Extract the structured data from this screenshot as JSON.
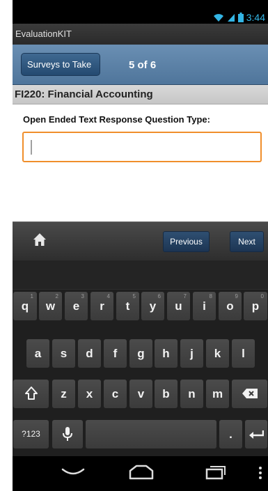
{
  "status_bar": {
    "time": "3:44",
    "icons": [
      "wifi-icon",
      "signal-icon",
      "battery-icon"
    ]
  },
  "app": {
    "title": "EvaluationKIT"
  },
  "nav": {
    "back_label": "Surveys to Take",
    "page_counter": "5 of 6"
  },
  "course": {
    "title": "FI220:  Financial Accounting"
  },
  "question": {
    "label": "Open Ended Text Response Question Type:",
    "value": ""
  },
  "toolbar": {
    "home_icon": "home-icon",
    "previous_label": "Previous",
    "next_label": "Next"
  },
  "keyboard": {
    "row1": [
      "q",
      "w",
      "e",
      "r",
      "t",
      "y",
      "u",
      "i",
      "o",
      "p"
    ],
    "row1_nums": [
      "1",
      "2",
      "3",
      "4",
      "5",
      "6",
      "7",
      "8",
      "9",
      "0"
    ],
    "row2": [
      "a",
      "s",
      "d",
      "f",
      "g",
      "h",
      "j",
      "k",
      "l"
    ],
    "row3": [
      "z",
      "x",
      "c",
      "v",
      "b",
      "n",
      "m"
    ],
    "shift_icon": "shift-icon",
    "backspace_icon": "backspace-icon",
    "symbols_label": "?123",
    "mic_icon": "microphone-icon",
    "period_label": ".",
    "enter_icon": "enter-icon"
  },
  "system_nav": {
    "icons": [
      "back-icon",
      "home-icon",
      "recent-apps-icon",
      "menu-icon"
    ]
  },
  "colors": {
    "accent_blue": "#4f759b",
    "field_border": "#f08e2b",
    "time": "#33b5e5"
  }
}
